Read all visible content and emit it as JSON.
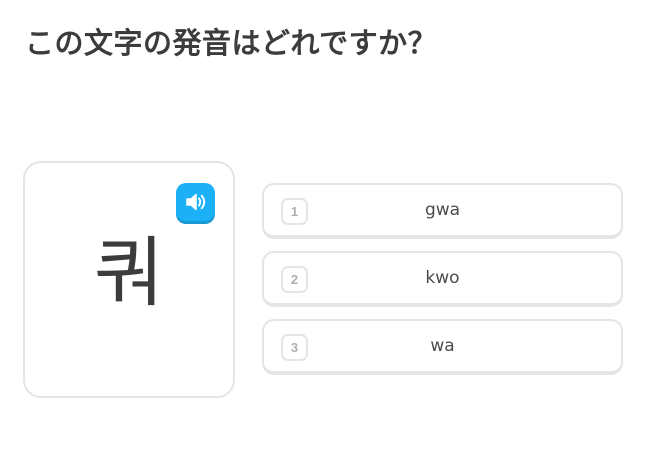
{
  "question": {
    "title": "この文字の発音はどれですか？"
  },
  "character_card": {
    "character": "쿼",
    "audio_icon": "speaker-icon",
    "audio_color": "#1cb0f6"
  },
  "choices": [
    {
      "number": "1",
      "label": "gwa"
    },
    {
      "number": "2",
      "label": "kwo"
    },
    {
      "number": "3",
      "label": "wa"
    }
  ]
}
